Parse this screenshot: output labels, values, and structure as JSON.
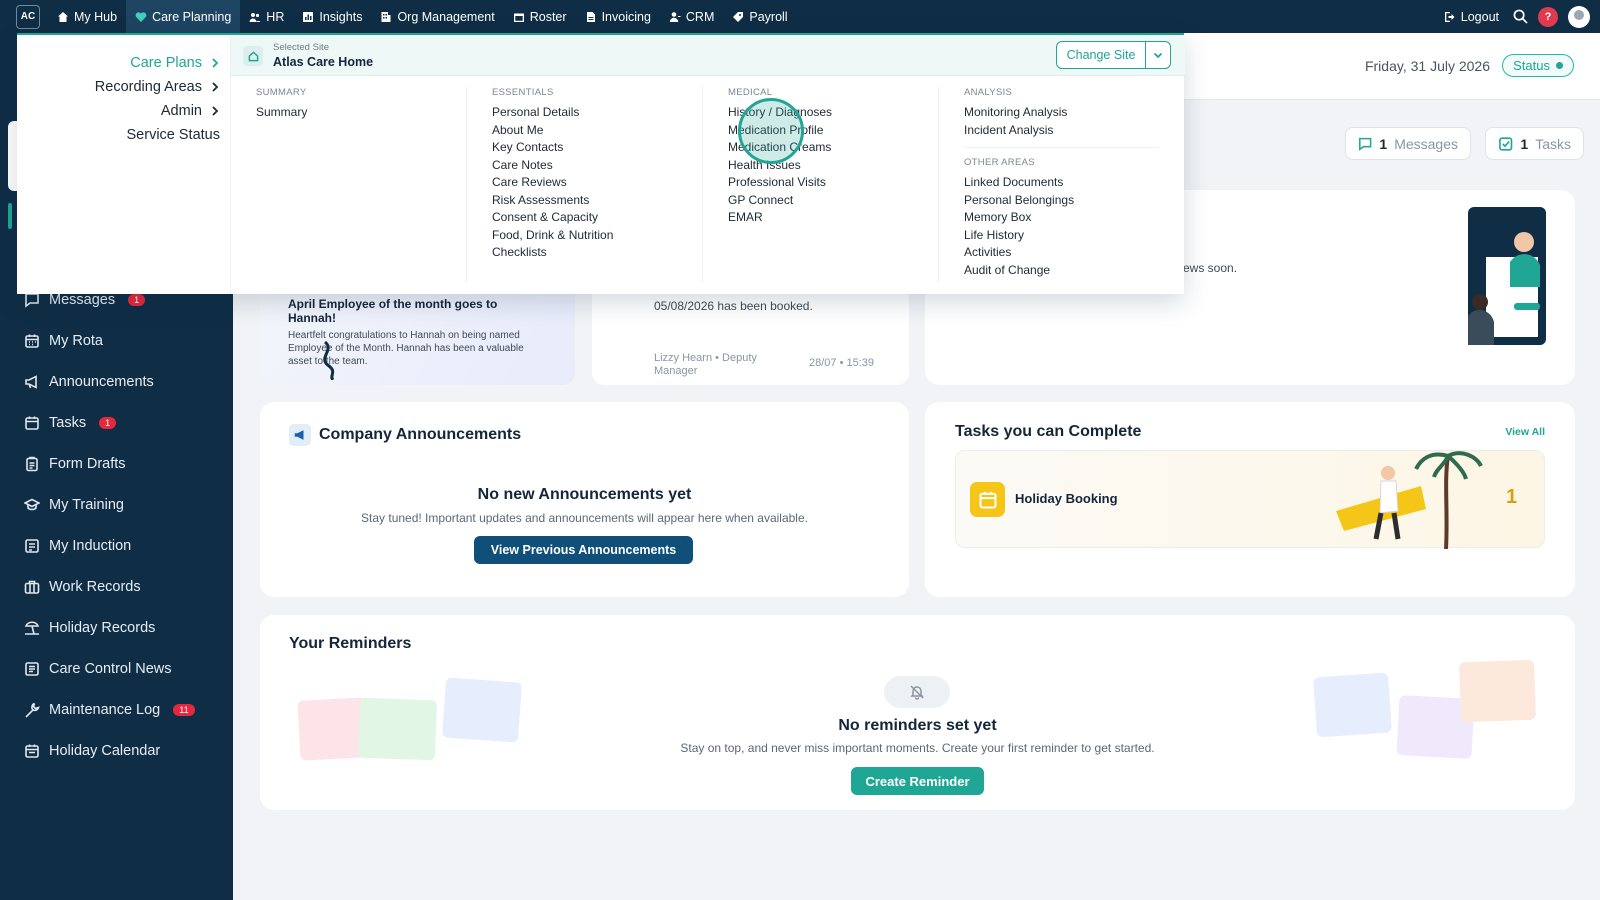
{
  "topnav": {
    "logo": "AC",
    "items": [
      {
        "label": "My Hub",
        "icon": "home-icon"
      },
      {
        "label": "Care Planning",
        "icon": "heart-icon",
        "active": true
      },
      {
        "label": "HR",
        "icon": "people-icon"
      },
      {
        "label": "Insights",
        "icon": "chart-icon"
      },
      {
        "label": "Org Management",
        "icon": "building-icon"
      },
      {
        "label": "Roster",
        "icon": "calendar-icon"
      },
      {
        "label": "Invoicing",
        "icon": "document-icon"
      },
      {
        "label": "CRM",
        "icon": "users-icon"
      },
      {
        "label": "Payroll",
        "icon": "tag-icon"
      }
    ],
    "logout": "Logout",
    "help": "?"
  },
  "sidebar": {
    "items": [
      {
        "label": "Messages",
        "icon": "chat-icon",
        "badge": "1"
      },
      {
        "label": "My Rota",
        "icon": "calendar-grid-icon"
      },
      {
        "label": "Announcements",
        "icon": "megaphone-icon"
      },
      {
        "label": "Tasks",
        "icon": "calendar-icon",
        "badge": "1"
      },
      {
        "label": "Form Drafts",
        "icon": "clipboard-icon"
      },
      {
        "label": "My Training",
        "icon": "graduation-icon"
      },
      {
        "label": "My Induction",
        "icon": "induction-icon"
      },
      {
        "label": "Work Records",
        "icon": "briefcase-icon"
      },
      {
        "label": "Holiday Records",
        "icon": "beach-icon"
      },
      {
        "label": "Care Control News",
        "icon": "news-icon"
      },
      {
        "label": "Maintenance Log",
        "icon": "wrench-icon",
        "badge": "11"
      },
      {
        "label": "Holiday Calendar",
        "icon": "calendar-icon"
      }
    ]
  },
  "header": {
    "date": "Friday, 31 July 2026",
    "status": "Status"
  },
  "quick": {
    "messages_count": "1",
    "messages_label": "Messages",
    "tasks_count": "1",
    "tasks_label": "Tasks"
  },
  "news": {
    "title": "April Employee of the month goes to Hannah!",
    "body": "Heartfelt congratulations to Hannah on being named Employee of the Month. Hannah has been a valuable asset to the team."
  },
  "message_preview": {
    "line": "05/08/2026 has been booked.",
    "author": "Lizzy Hearn • Deputy Manager",
    "time": "28/07 • 15:39"
  },
  "news_soon": "ews soon.",
  "announcements": {
    "title": "Company Announcements",
    "empty_title": "No new Announcements yet",
    "empty_sub": "Stay tuned! Important updates and announcements will appear here when available.",
    "button": "View Previous Announcements"
  },
  "tasks_card": {
    "title": "Tasks you can Complete",
    "view_all": "View All",
    "task_label": "Holiday Booking",
    "task_count": "1"
  },
  "reminders": {
    "title": "Your Reminders",
    "empty_title": "No reminders set yet",
    "empty_sub": "Stay on top, and never miss important moments. Create your first reminder to get started.",
    "button": "Create Reminder"
  },
  "dropdown": {
    "left_items": [
      {
        "label": "Care Plans",
        "active": true,
        "chevron": true
      },
      {
        "label": "Recording Areas",
        "chevron": true
      },
      {
        "label": "Admin",
        "chevron": true
      },
      {
        "label": "Service Status",
        "chevron": false
      }
    ],
    "site_label": "Selected Site",
    "site_name": "Atlas Care Home",
    "change_site": "Change Site",
    "columns": [
      {
        "groups": [
          {
            "heading": "SUMMARY",
            "links": [
              "Summary"
            ]
          }
        ]
      },
      {
        "groups": [
          {
            "heading": "ESSENTIALS",
            "links": [
              "Personal Details",
              "About Me",
              "Key Contacts",
              "Care Notes",
              "Care Reviews",
              "Risk Assessments",
              "Consent & Capacity",
              "Food, Drink & Nutrition",
              "Checklists"
            ]
          }
        ]
      },
      {
        "groups": [
          {
            "heading": "MEDICAL",
            "links": [
              "History / Diagnoses",
              "Medication Profile",
              "Medication Creams",
              "Health Issues",
              "Professional Visits",
              "GP Connect",
              "EMAR"
            ]
          }
        ]
      },
      {
        "groups": [
          {
            "heading": "ANALYSIS",
            "links": [
              "Monitoring Analysis",
              "Incident Analysis"
            ]
          },
          {
            "heading": "OTHER AREAS",
            "links": [
              "Linked Documents",
              "Personal Belongings",
              "Memory Box",
              "Life History",
              "Activities",
              "Audit of Change"
            ]
          }
        ]
      }
    ]
  },
  "colors": {
    "navy": "#0f2d45",
    "teal": "#1fa694",
    "alert": "#e5283d",
    "button_blue": "#0f4f7a"
  }
}
